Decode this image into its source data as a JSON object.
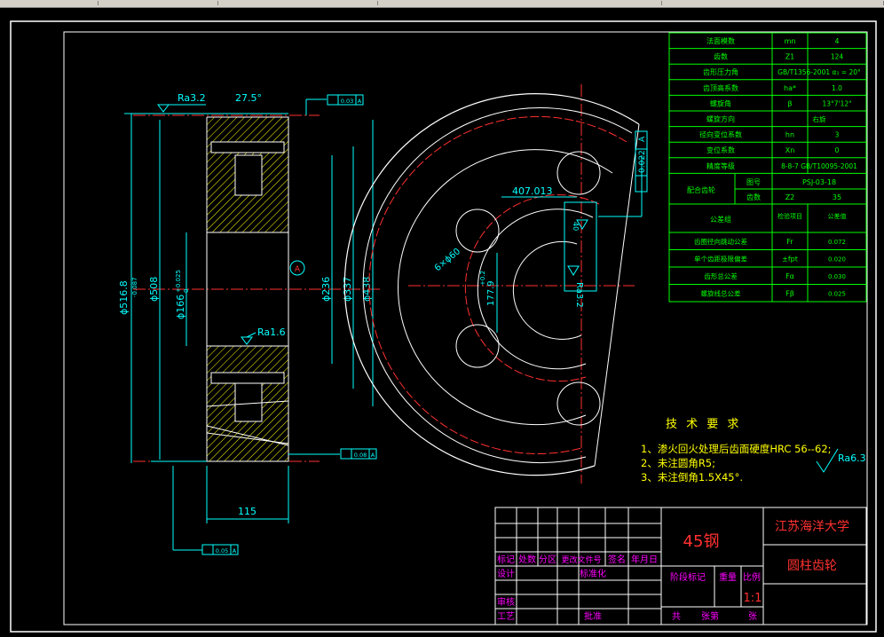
{
  "colors": {
    "background": "#000000",
    "border": "#ffffff",
    "geometry": "#ffffff",
    "dimension": "#00ffff",
    "table": "#00ff00",
    "center": "#ff3030",
    "hatch": "#ffff00",
    "title_text": "#ff3030",
    "header_text": "#ff00ff",
    "note_text": "#ffff00"
  },
  "section_view": {
    "dims": {
      "width_top": "27.5°",
      "roughness_top": "Ra3.2",
      "tol_top": "0.03",
      "datum_top": "A",
      "dia_outer": "ϕ516.8",
      "dia_outer_tol": "-0.087",
      "dia_pitch": "ϕ508",
      "dia_bore": "ϕ166",
      "dia_bore_tol": "+0.025",
      "dia_bore_tol2": "0",
      "dia_236": "ϕ236",
      "dia_337": "ϕ337",
      "dia_438": "ϕ438",
      "datum_label": "A",
      "roughness_mid": "Ra1.6",
      "tol_bottom": "0.08",
      "datum_bottom": "A",
      "width": "115",
      "tol_low": "0.05",
      "datum_low": "A"
    }
  },
  "face_view": {
    "dims": {
      "chord": "407.013",
      "hole": "6×ϕ60",
      "keyway_h": "177.9",
      "keyway_tol": "+0.2",
      "keyway_w": "40",
      "keyway_ra": "Ra3.2",
      "tol_right": "0.022",
      "datum_right": "A"
    }
  },
  "param_table": {
    "rows": [
      {
        "name": "法面模数",
        "sym": "mn",
        "val": "4"
      },
      {
        "name": "齿数",
        "sym": "Z1",
        "val": "124"
      },
      {
        "name": "齿形压力角",
        "sym": "GB/T1356-2001 α₁ = 20°",
        "val": ""
      },
      {
        "name": "齿顶高系数",
        "sym": "ha*",
        "val": "1.0"
      },
      {
        "name": "螺旋角",
        "sym": "β",
        "val": "13°7'12\""
      },
      {
        "name": "螺旋方向",
        "sym": "右旋",
        "val": ""
      },
      {
        "name": "径向变位系数",
        "sym": "hn",
        "val": "3"
      },
      {
        "name": "变位系数",
        "sym": "Xn",
        "val": "0"
      },
      {
        "name": "精度等级",
        "sym": "8-8-7 GB/T10095-2001",
        "val": ""
      }
    ],
    "mate": {
      "label": "配合齿轮",
      "fig_label": "图号",
      "fig_val": "PSJ-03-18",
      "teeth_label": "齿数",
      "teeth_sym": "Z2",
      "teeth_val": "35"
    },
    "tol_header": {
      "label": "公差组",
      "col2": "检验项目",
      "col3": "公差值"
    },
    "tol_rows": [
      {
        "name": "齿圈径向跳动公差",
        "sym": "Fr",
        "val": "0.072"
      },
      {
        "name": "单个齿距极限偏差",
        "sym": "±fpt",
        "val": "0.020"
      },
      {
        "name": "齿形总公差",
        "sym": "Fα",
        "val": "0.030"
      },
      {
        "name": "螺旋线总公差",
        "sym": "Fβ",
        "val": "0.025"
      }
    ]
  },
  "notes": {
    "title": "技 术 要 求",
    "line1": "1、渗火回火处理后齿面硬度HRC 56--62;",
    "line2": "2、未注圆角R5;",
    "line3": "3、未注倒角1.5X45°.",
    "rest_roughness": "Ra6.3"
  },
  "title_block": {
    "material": "45钢",
    "school": "江苏海洋大学",
    "part_name": "圆柱齿轮",
    "h_mark": "标记",
    "h_count": "处数",
    "h_zone": "分区",
    "h_doc": "更改文件号",
    "h_sign": "签名",
    "h_date": "年月日",
    "design": "设计",
    "standardize": "标准化",
    "check": "审核",
    "process": "工艺",
    "approve": "批准",
    "stage": "阶段标记",
    "weight": "重量",
    "scale_label": "比例",
    "scale": "1:1",
    "sheets_total": "共",
    "sheets_page": "张第",
    "sheets_end": "张"
  }
}
